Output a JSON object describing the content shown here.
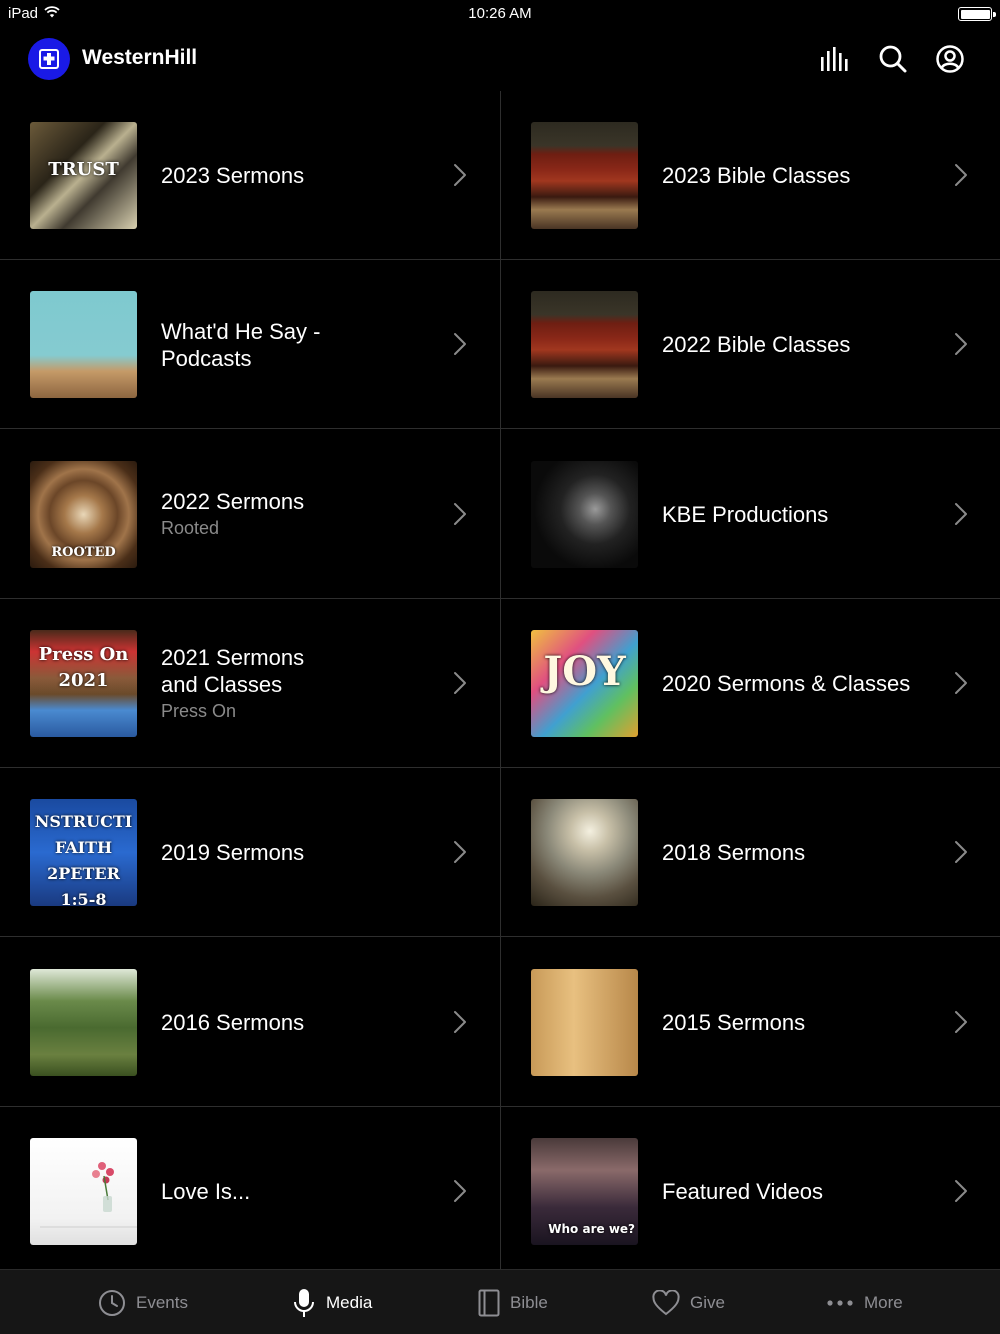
{
  "status_bar": {
    "device": "iPad",
    "time": "10:26 AM"
  },
  "header": {
    "app_title": "WesternHill",
    "icons": [
      "audio-bars-icon",
      "search-icon",
      "account-icon"
    ]
  },
  "items": [
    {
      "title": "2023 Sermons",
      "subtitle": "",
      "thumb": "trust",
      "thumb_text": "TRUST"
    },
    {
      "title": "2023 Bible Classes",
      "subtitle": "",
      "thumb": "bible",
      "thumb_text": ""
    },
    {
      "title": "What'd He Say - Podcasts",
      "subtitle": "",
      "thumb": "podcast",
      "thumb_text": ""
    },
    {
      "title": "2022 Bible Classes",
      "subtitle": "",
      "thumb": "bible",
      "thumb_text": ""
    },
    {
      "title": "2022 Sermons",
      "subtitle": "Rooted",
      "thumb": "rooted",
      "thumb_text": "ROOTED"
    },
    {
      "title": "KBE Productions",
      "subtitle": "",
      "thumb": "kbe",
      "thumb_text": ""
    },
    {
      "title": "2021 Sermons and Classes",
      "subtitle": "Press On",
      "thumb": "press",
      "thumb_text": "Press On 2021"
    },
    {
      "title": "2020 Sermons & Classes",
      "subtitle": "",
      "thumb": "joy",
      "thumb_text": "JOY"
    },
    {
      "title": "2019 Sermons",
      "subtitle": "",
      "thumb": "faith",
      "thumb_text": "NSTRUCTI FAITH 2PETER 1:5-8"
    },
    {
      "title": "2018 Sermons",
      "subtitle": "",
      "thumb": "2018",
      "thumb_text": ""
    },
    {
      "title": "2016 Sermons",
      "subtitle": "",
      "thumb": "sheep",
      "thumb_text": ""
    },
    {
      "title": "2015 Sermons",
      "subtitle": "",
      "thumb": "2015",
      "thumb_text": ""
    },
    {
      "title": "Love Is...",
      "subtitle": "",
      "thumb": "love",
      "thumb_text": ""
    },
    {
      "title": "Featured Videos",
      "subtitle": "",
      "thumb": "featured",
      "thumb_text": "Who are we?"
    }
  ],
  "tabs": [
    {
      "label": "Events",
      "icon": "clock-icon",
      "active": false
    },
    {
      "label": "Media",
      "icon": "microphone-icon",
      "active": true
    },
    {
      "label": "Bible",
      "icon": "book-icon",
      "active": false
    },
    {
      "label": "Give",
      "icon": "heart-icon",
      "active": false
    },
    {
      "label": "More",
      "icon": "more-dots-icon",
      "active": false
    }
  ]
}
